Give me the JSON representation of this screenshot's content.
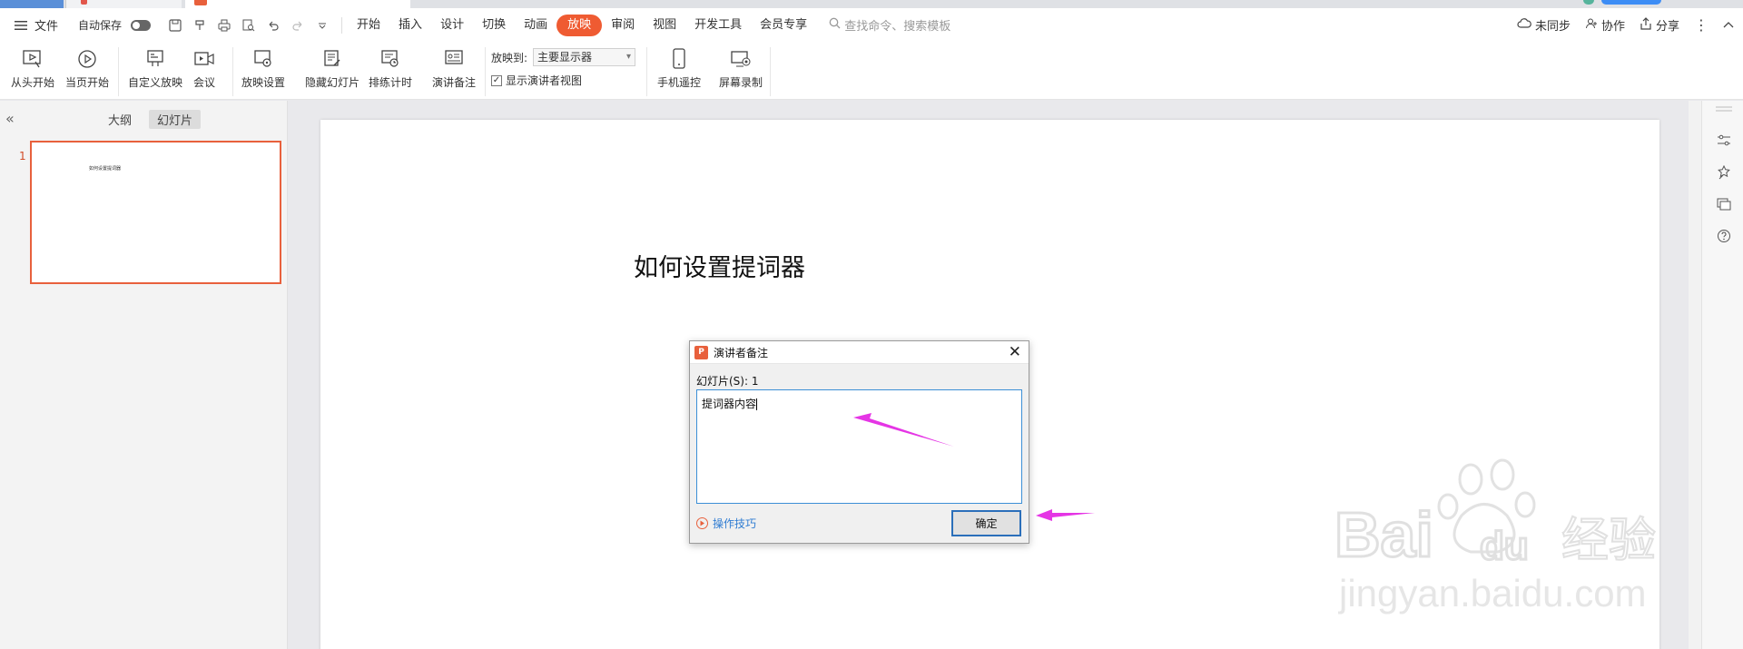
{
  "menubar": {
    "file_label": "文件",
    "autosave_label": "自动保存",
    "tabs": [
      {
        "label": "开始"
      },
      {
        "label": "插入"
      },
      {
        "label": "设计"
      },
      {
        "label": "切换"
      },
      {
        "label": "动画"
      },
      {
        "label": "放映",
        "active": true
      },
      {
        "label": "审阅"
      },
      {
        "label": "视图"
      },
      {
        "label": "开发工具"
      },
      {
        "label": "会员专享"
      }
    ],
    "search_placeholder": "查找命令、搜索模板",
    "right": {
      "sync": "未同步",
      "collab": "协作",
      "share": "分享"
    }
  },
  "ribbon": {
    "from_start": "从头开始",
    "from_current": "当页开始",
    "custom_show": "自定义放映",
    "meeting": "会议",
    "show_settings": "放映设置",
    "hide_slide": "隐藏幻灯片",
    "rehearse": "排练计时",
    "speaker_notes": "演讲备注",
    "play_to_label": "放映到:",
    "play_to_value": "主要显示器",
    "show_presenter_view": "显示演讲者视图",
    "show_presenter_view_checked": true,
    "phone_remote": "手机遥控",
    "screen_record": "屏幕录制"
  },
  "left_pane": {
    "tab_outline": "大纲",
    "tab_slides": "幻灯片",
    "slide_number": "1",
    "thumb_title": "如何设置提词器"
  },
  "slide": {
    "title": "如何设置提词器"
  },
  "dialog": {
    "title": "演讲者备注",
    "slide_label": "幻灯片(S): 1",
    "notes_text": "提词器内容",
    "tips": "操作技巧",
    "ok": "确定"
  },
  "colors": {
    "accent": "#ef5b32",
    "annotation_arrow": "#e535e5",
    "focus_border": "#3c8fd6"
  }
}
